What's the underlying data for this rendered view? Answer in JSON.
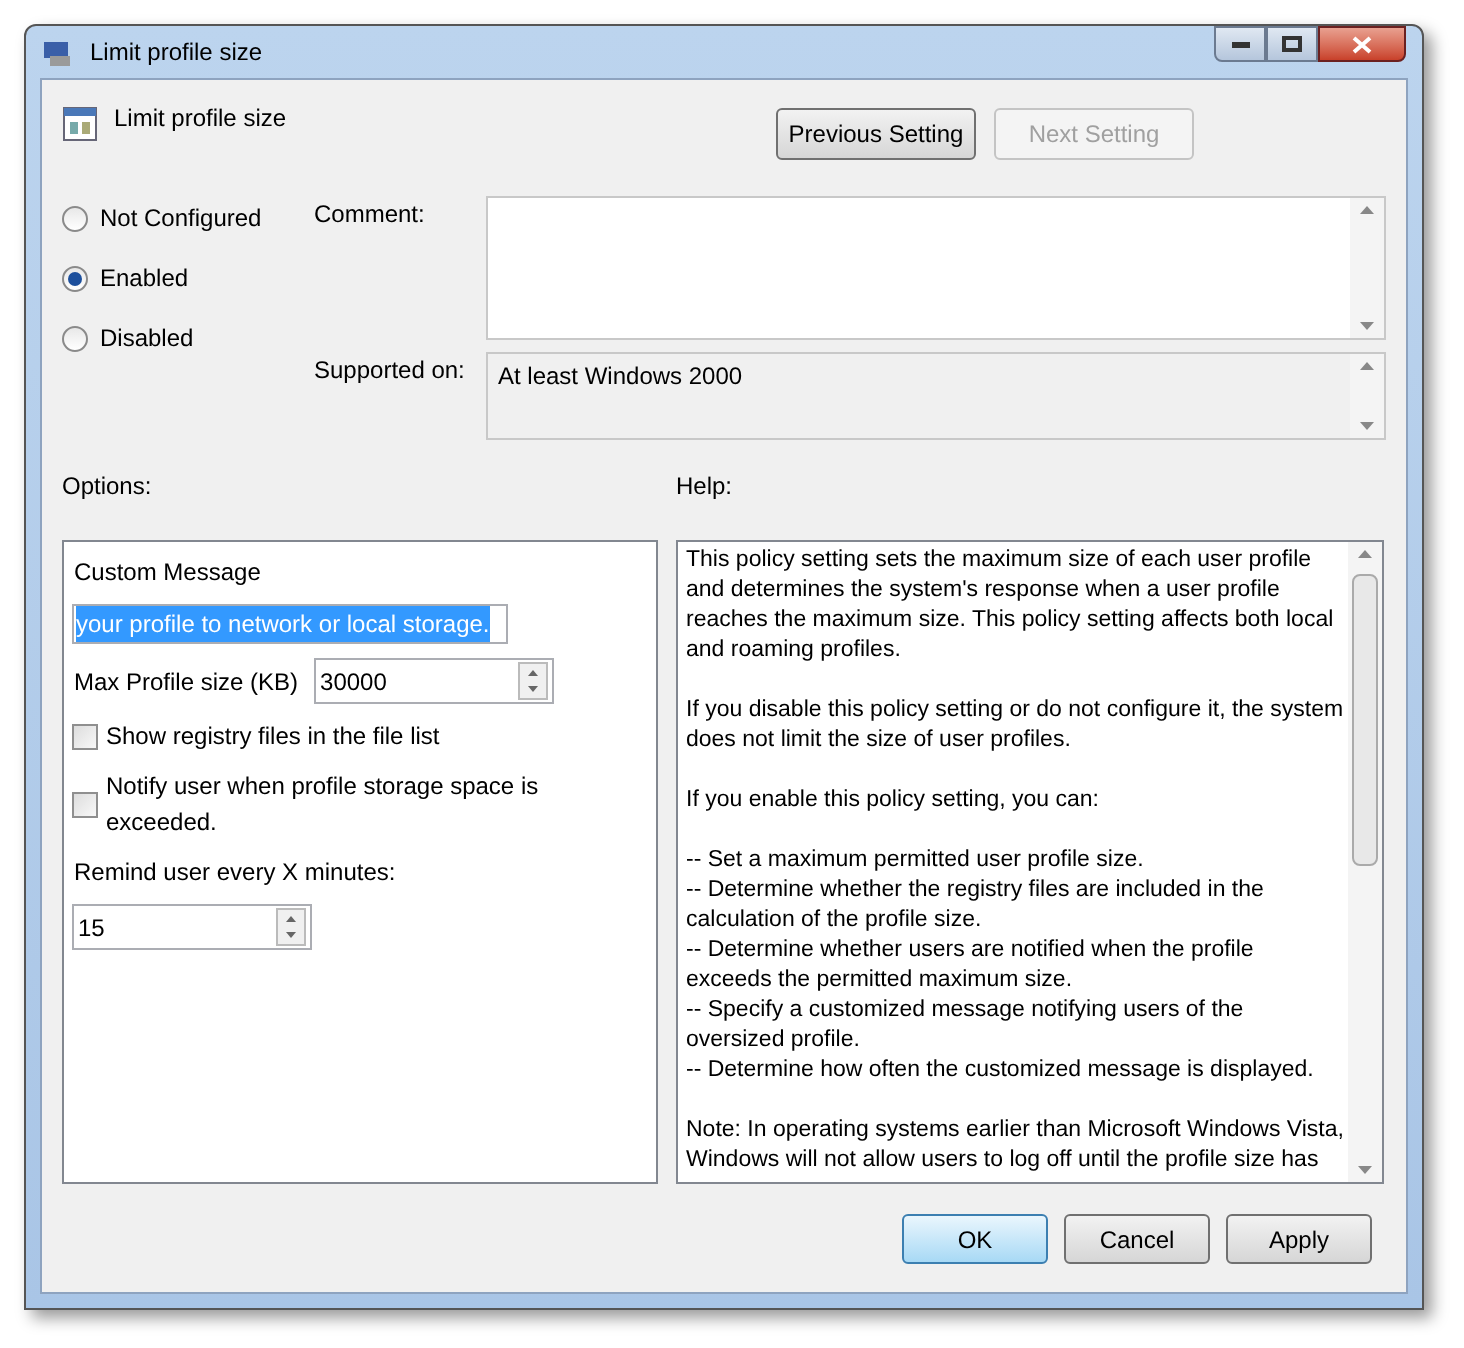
{
  "window": {
    "title": "Limit profile size"
  },
  "header": {
    "title": "Limit profile size"
  },
  "nav_buttons": [
    {
      "label": "Previous Setting",
      "disabled": false
    },
    {
      "label": "Next Setting",
      "disabled": true
    }
  ],
  "state_options": [
    {
      "label": "Not Configured",
      "selected": false
    },
    {
      "label": "Enabled",
      "selected": true
    },
    {
      "label": "Disabled",
      "selected": false
    }
  ],
  "comment": {
    "label": "Comment:"
  },
  "supported_on": {
    "label": "Supported on:",
    "value": "At least Windows 2000"
  },
  "options": {
    "label": "Options:",
    "items": [
      {
        "kind": "label",
        "text": "Custom Message"
      },
      {
        "kind": "text",
        "value": "your profile to network or local storage."
      },
      {
        "kind": "spin",
        "label": "Max Profile size (KB)",
        "value": "30000"
      },
      {
        "kind": "checkbox",
        "label": "Show registry files in the file list",
        "checked": false
      },
      {
        "kind": "checkbox",
        "label": "Notify user when profile storage space is exceeded.",
        "checked": false
      },
      {
        "kind": "label",
        "text": "Remind user every X minutes:"
      },
      {
        "kind": "spin",
        "value": "15"
      }
    ]
  },
  "help": {
    "label": "Help:",
    "paragraphs": [
      "This policy setting sets the maximum size of each user profile and determines the system's response when a user profile reaches the maximum size. This policy setting affects both local and roaming profiles.",
      "If you disable this policy setting or do not configure it, the system does not limit the size of user profiles.",
      "If you enable this policy setting, you can:",
      "-- Set a maximum permitted user profile size.\n-- Determine whether the registry files are included in the calculation of the profile size.\n-- Determine whether users are notified when the profile exceeds the permitted maximum size.\n-- Specify a customized message notifying users of the oversized profile.\n-- Determine how often the customized message is displayed.",
      "Note: In operating systems earlier than Microsoft Windows Vista, Windows will not allow users to log off until the profile size has"
    ]
  },
  "buttons": [
    {
      "label": "OK",
      "selected": true
    },
    {
      "label": "Cancel",
      "selected": false
    },
    {
      "label": "Apply",
      "selected": false
    }
  ]
}
